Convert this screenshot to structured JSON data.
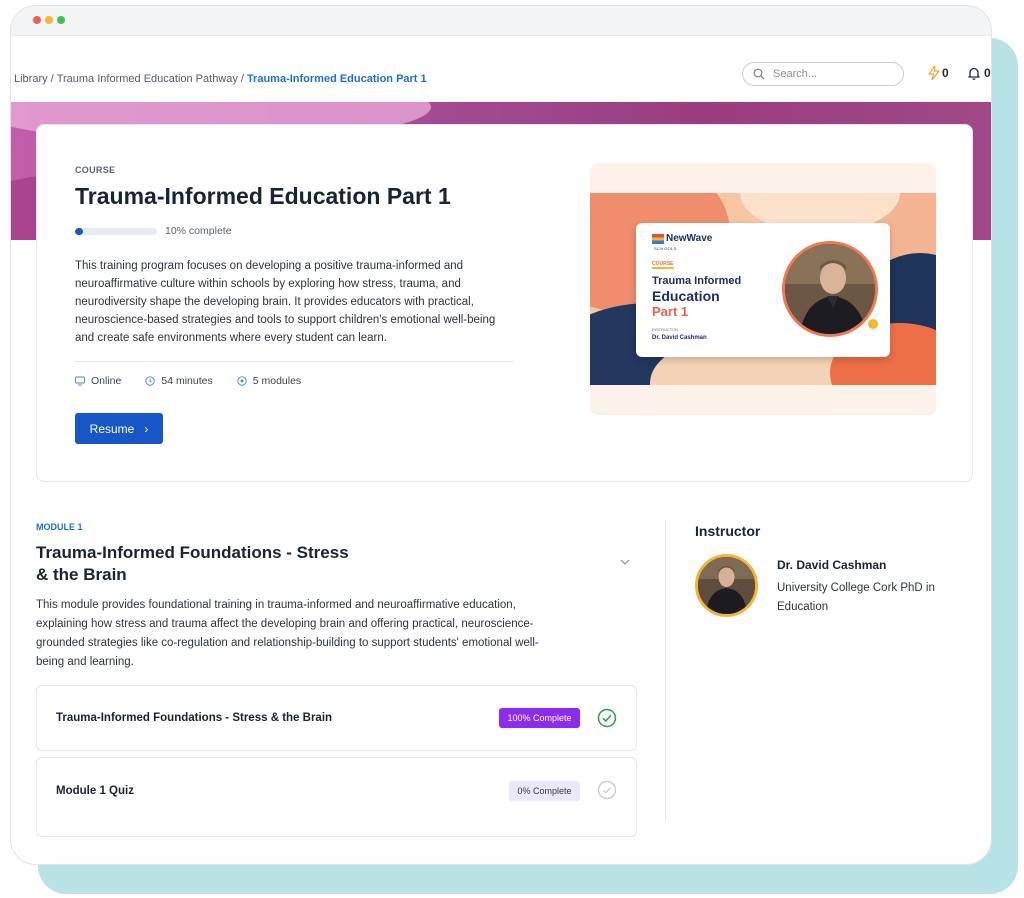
{
  "breadcrumb": {
    "items": [
      "Library",
      "Trauma Informed Education Pathway"
    ],
    "current": "Trauma-Informed Education Part 1",
    "separator": "/"
  },
  "search": {
    "placeholder": "Search..."
  },
  "header": {
    "points": "0",
    "notifications": "0"
  },
  "course": {
    "kicker": "COURSE",
    "title": "Trauma-Informed Education Part 1",
    "progress_percent": 10,
    "progress_text": "10% complete",
    "description": "This training program focuses on developing a positive trauma-informed and neuroaffirmative culture within schools by exploring how stress, trauma, and neurodiversity shape the developing brain. It provides educators with practical, neuroscience-based strategies and tools to support children's emotional well-being and create safe environments where every student can learn.",
    "meta": {
      "format": "Online",
      "duration": "54 minutes",
      "modules": "5 modules"
    },
    "resume_label": "Resume"
  },
  "thumbnail": {
    "logo": "NewWave",
    "logo_sub": "SCHOOLS",
    "kicker": "COURSE",
    "line1": "Trauma Informed",
    "line2": "Education",
    "line3": "Part 1",
    "instructor_label": "INSTRUCTOR",
    "instructor_name": "Dr. David Cashman"
  },
  "module": {
    "kicker": "MODULE 1",
    "title": "Trauma-Informed Foundations - Stress & the Brain",
    "description": "This module provides foundational training in trauma-informed and neuroaffirmative education, explaining how stress and trauma affect the developing brain and offering practical, neuroscience-grounded strategies like co-regulation and relationship-building to support students' emotional well-being and learning.",
    "lessons": [
      {
        "title": "Trauma-Informed Foundations - Stress & the Brain",
        "status": "100% Complete"
      },
      {
        "title": "Module 1 Quiz",
        "status": "0% Complete"
      }
    ]
  },
  "instructor": {
    "heading": "Instructor",
    "name": "Dr. David Cashman",
    "bio": "University College Cork PhD in Education"
  },
  "colors": {
    "primary": "#1756c7",
    "link": "#1e6fd1",
    "complete_badge": "#8b2cf0",
    "banner": "#a64f98",
    "check_done": "#2e9d4b"
  }
}
